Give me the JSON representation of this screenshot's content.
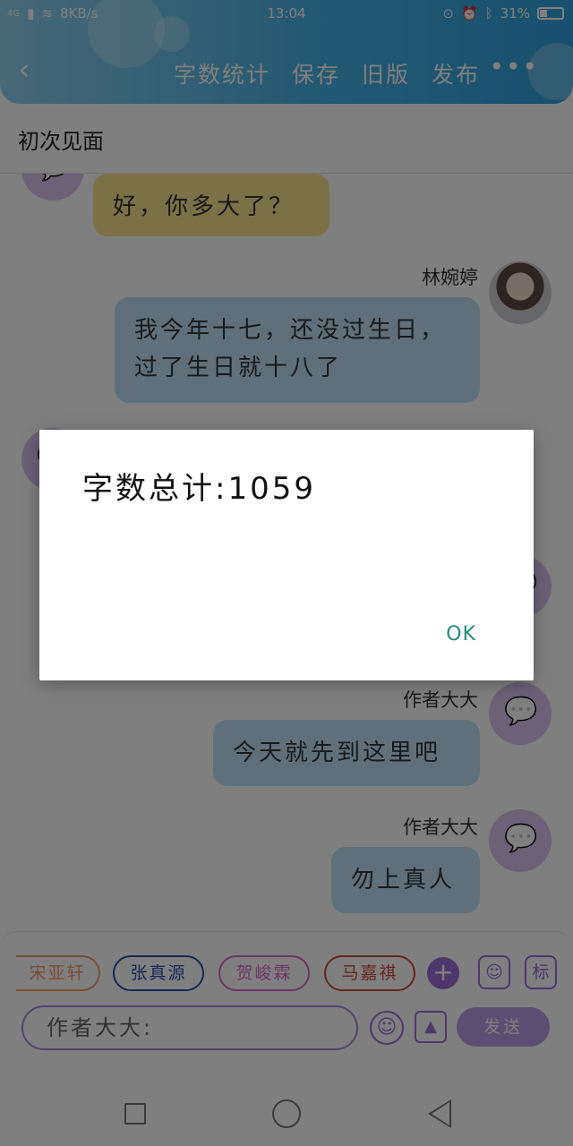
{
  "status": {
    "network": "4G",
    "speed": "8KB/s",
    "time": "13:04",
    "battery": "31%"
  },
  "header": {
    "back_icon": "chevron-left-icon",
    "actions": [
      "字数统计",
      "保存",
      "旧版",
      "发布"
    ],
    "more_label": "•••"
  },
  "chapter_title": "初次见面",
  "messages": [
    {
      "text": "好，你多大了？"
    },
    {
      "sender": "林婉婷",
      "text": "我今年十七，还没过生日，过了生日就十八了"
    },
    {
      "sender": "作者大大",
      "text": "今天就先到这里吧"
    },
    {
      "sender": "作者大大",
      "text": "勿上真人"
    }
  ],
  "characters": [
    {
      "name": "宋亚轩",
      "color": "#f09a6b"
    },
    {
      "name": "张真源",
      "color": "#2a4fa8"
    },
    {
      "name": "贺峻霖",
      "color": "#d86cc8"
    },
    {
      "name": "马嘉祺",
      "color": "#d04a3a"
    }
  ],
  "toolbar": {
    "add_label": "+",
    "tag_label": "标",
    "input_value": "作者大大:",
    "send_label": "发送"
  },
  "dialog": {
    "message": "字数总计:1059",
    "ok_label": "OK"
  },
  "colors": {
    "accent_purple": "#9c6ed8",
    "header_blue": "#48b2e4",
    "bubble_yellow": "#f7e28c",
    "bubble_blue": "#bfe0f5",
    "ok_teal": "#2a8a84"
  }
}
